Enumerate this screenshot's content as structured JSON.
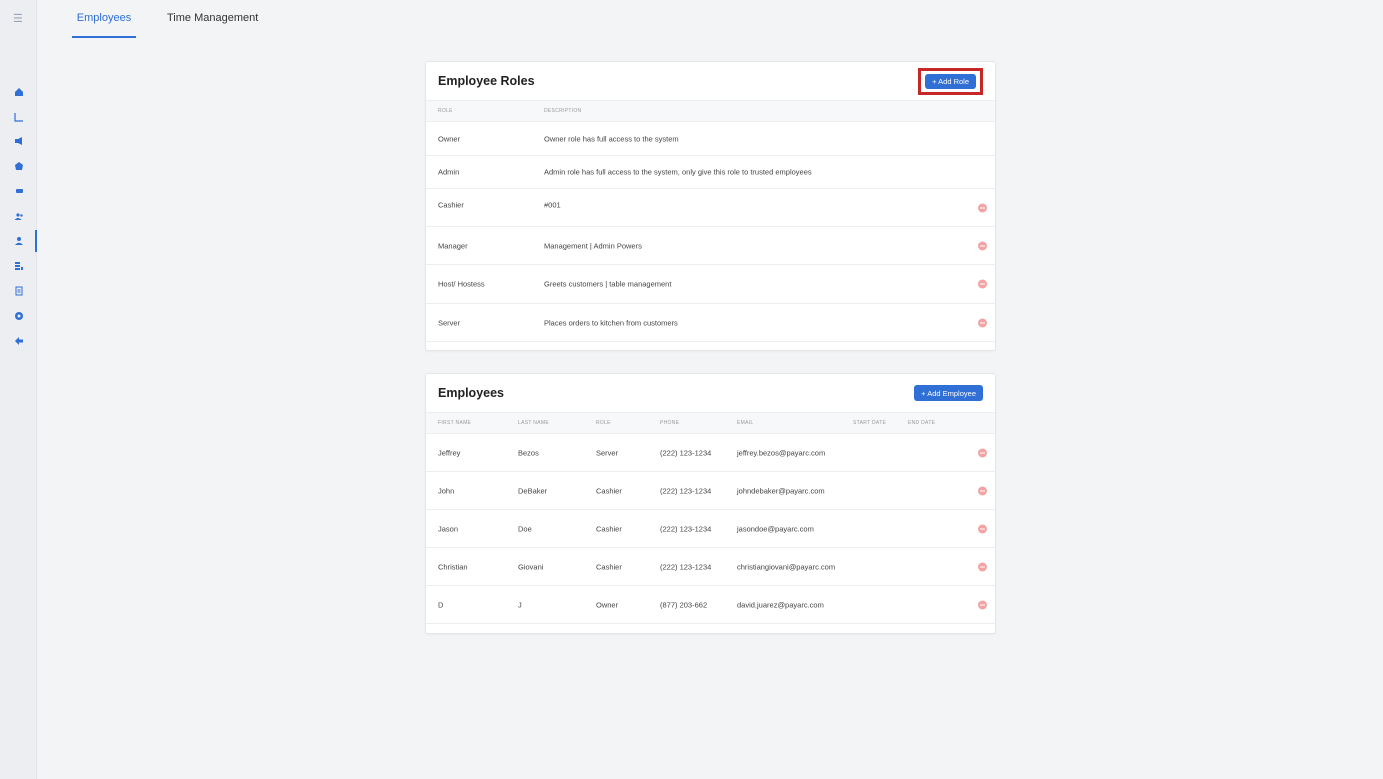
{
  "sidebar": {
    "menu_icon": "menu-icon",
    "items": [
      "home-icon",
      "chart-icon",
      "campaign-icon",
      "store-icon",
      "payments-icon",
      "customers-icon",
      "employees-icon",
      "inventory-icon",
      "reports-icon",
      "settings-icon",
      "logout-icon"
    ],
    "active": "employees-icon"
  },
  "tabs": [
    {
      "label": "Employees",
      "active": true
    },
    {
      "label": "Time Management",
      "active": false
    }
  ],
  "roles": {
    "title": "Employee Roles",
    "add_label": "+ Add Role",
    "columns": [
      "ROLE",
      "DESCRIPTION"
    ],
    "rows": [
      {
        "role": "Owner",
        "description": "Owner role has full access to the system",
        "editable": false
      },
      {
        "role": "Admin",
        "description": "Admin role has full access to the system, only give this role to trusted employees",
        "editable": false
      },
      {
        "role": "Cashier",
        "description": "#001",
        "editable": true
      },
      {
        "role": "Manager",
        "description": "Management | Admin Powers",
        "editable": true
      },
      {
        "role": "Host/ Hostess",
        "description": "Greets customers | table management",
        "editable": true
      },
      {
        "role": "Server",
        "description": "Places orders to kitchen from customers",
        "editable": true
      }
    ]
  },
  "employees": {
    "title": "Employees",
    "add_label": "+ Add Employee",
    "columns": [
      "FIRST NAME",
      "LAST NAME",
      "ROLE",
      "PHONE",
      "EMAIL",
      "START DATE",
      "END DATE"
    ],
    "rows": [
      {
        "first": "Jeffrey",
        "last": "Bezos",
        "role": "Server",
        "phone": "(222) 123-1234",
        "email": "jeffrey.bezos@payarc.com",
        "start": "",
        "end": ""
      },
      {
        "first": "John",
        "last": "DeBaker",
        "role": "Cashier",
        "phone": "(222) 123-1234",
        "email": "johndebaker@payarc.com",
        "start": "",
        "end": ""
      },
      {
        "first": "Jason",
        "last": "Doe",
        "role": "Cashier",
        "phone": "(222) 123-1234",
        "email": "jasondoe@payarc.com",
        "start": "",
        "end": ""
      },
      {
        "first": "Christian",
        "last": "Giovani",
        "role": "Cashier",
        "phone": "(222) 123-1234",
        "email": "christiangiovani@payarc.com",
        "start": "",
        "end": ""
      },
      {
        "first": "D",
        "last": "J",
        "role": "Owner",
        "phone": "(877) 203-662",
        "email": "david.juarez@payarc.com",
        "start": "",
        "end": ""
      }
    ]
  },
  "colors": {
    "accent": "#2f6fd6",
    "highlight": "#c62828",
    "delete": "#f3a3a3"
  }
}
